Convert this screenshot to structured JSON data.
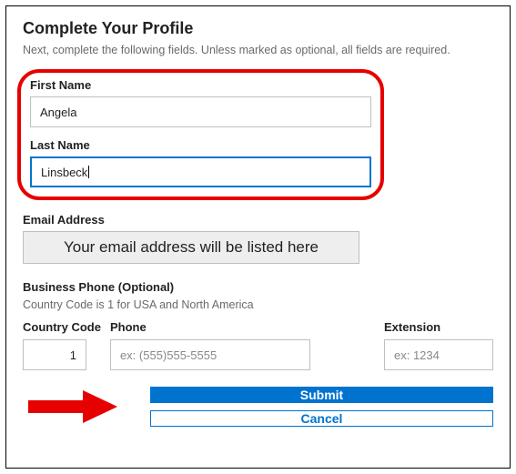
{
  "header": {
    "title": "Complete Your Profile",
    "subtitle": "Next, complete the following fields. Unless marked as optional, all fields are required."
  },
  "fields": {
    "first_name": {
      "label": "First Name",
      "value": "Angela"
    },
    "last_name": {
      "label": "Last Name",
      "value": "Linsbeck"
    },
    "email": {
      "label": "Email Address",
      "placeholder_display": "Your email address will be listed here"
    },
    "business_phone": {
      "label": "Business Phone (Optional)",
      "note": "Country Code is 1 for USA and North America",
      "country_code": {
        "label": "Country Code",
        "value": "1"
      },
      "phone": {
        "label": "Phone",
        "placeholder": "ex: (555)555-5555"
      },
      "extension": {
        "label": "Extension",
        "placeholder": "ex: 1234"
      }
    }
  },
  "buttons": {
    "submit": "Submit",
    "cancel": "Cancel"
  },
  "icons": {
    "arrow": "arrow-right"
  },
  "colors": {
    "accent": "#0073cf",
    "callout": "#e60000"
  }
}
